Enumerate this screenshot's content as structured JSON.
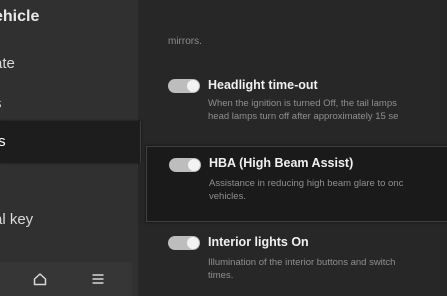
{
  "sidebar": {
    "header": "ehicle",
    "items": [
      {
        "label": "ate"
      },
      {
        "label": "s"
      },
      {
        "label": "ts",
        "selected": true
      },
      {
        "label": "al key"
      }
    ]
  },
  "bottom_bar": {
    "icons": [
      "home-icon",
      "menu-icon"
    ]
  },
  "content": {
    "previous_desc_tail": "mirrors.",
    "settings": [
      {
        "title": "Headlight time-out",
        "enabled": true,
        "description": "When the ignition is turned Off, the tail lamps\nhead lamps turn off after approximately 15 se"
      },
      {
        "title": "HBA (High Beam Assist)",
        "enabled": true,
        "selected": true,
        "description": "Assistance in reducing high beam glare to onc\nvehicles."
      },
      {
        "title": "Interior lights On",
        "enabled": true,
        "description": "Illumination of the interior buttons and switch\ntimes."
      }
    ]
  },
  "colors": {
    "background": "#272727",
    "sidebar": "#303030",
    "selected_row": "#1a1a1a",
    "toggle_track": "#bdbdbd",
    "toggle_knob": "#f2f2f2",
    "title_text": "#f0f0f0",
    "desc_text": "#8f8f8f"
  }
}
